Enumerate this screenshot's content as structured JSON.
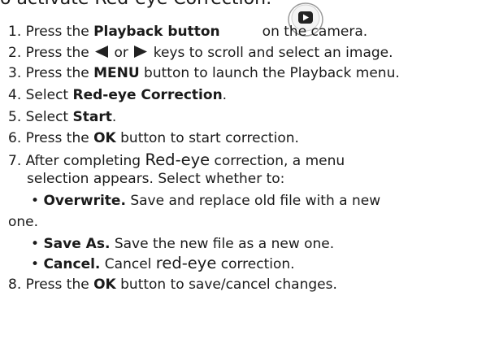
{
  "heading": "o activate Red-eye Correction:",
  "steps": {
    "s1": {
      "num": "1.",
      "pre": "Press the ",
      "bold": "Playback button",
      "post": "on the camera."
    },
    "s2": {
      "num": "2.",
      "pre": "Press the ",
      "mid": " or ",
      "post": " keys to scroll and select an image."
    },
    "s3": {
      "num": "3.",
      "pre": "Press the ",
      "bold": "MENU",
      "post": " button to launch the Playback menu."
    },
    "s4": {
      "num": "4.",
      "pre": "Select ",
      "bold": "Red-eye Correction",
      "post": "."
    },
    "s5": {
      "num": "5.",
      "pre": "Select ",
      "bold": "Start",
      "post": "."
    },
    "s6": {
      "num": "6.",
      "pre": "Press the ",
      "bold": "OK",
      "post": " button to start correction."
    },
    "s7": {
      "num": "7.",
      "line1_pre": "After completing ",
      "line1_big": "Red-eye",
      "line1_post": " correction, a menu",
      "line2": "selection appears. Select whether to:"
    },
    "s8": {
      "num": "8.",
      "pre": "Press the ",
      "bold": "OK",
      "post": " button to save/cancel changes."
    }
  },
  "options": {
    "overwrite": {
      "bullet": "•",
      "bold": "Overwrite.",
      "text": " Save and replace old file with a new",
      "cont": "one."
    },
    "save_as": {
      "bullet": "•",
      "bold": "Save As.",
      "text": " Save the new file as a new one."
    },
    "cancel": {
      "bullet": "•",
      "bold": "Cancel.",
      "text": " Cancel ",
      "big": "red-eye",
      "tail": " correction."
    }
  },
  "icons": {
    "playback": "playback-button-icon",
    "left": "left-arrow-key-icon",
    "right": "right-arrow-key-icon"
  },
  "colors": {
    "text": "#1a1a1a",
    "icon_fill": "#222222"
  }
}
